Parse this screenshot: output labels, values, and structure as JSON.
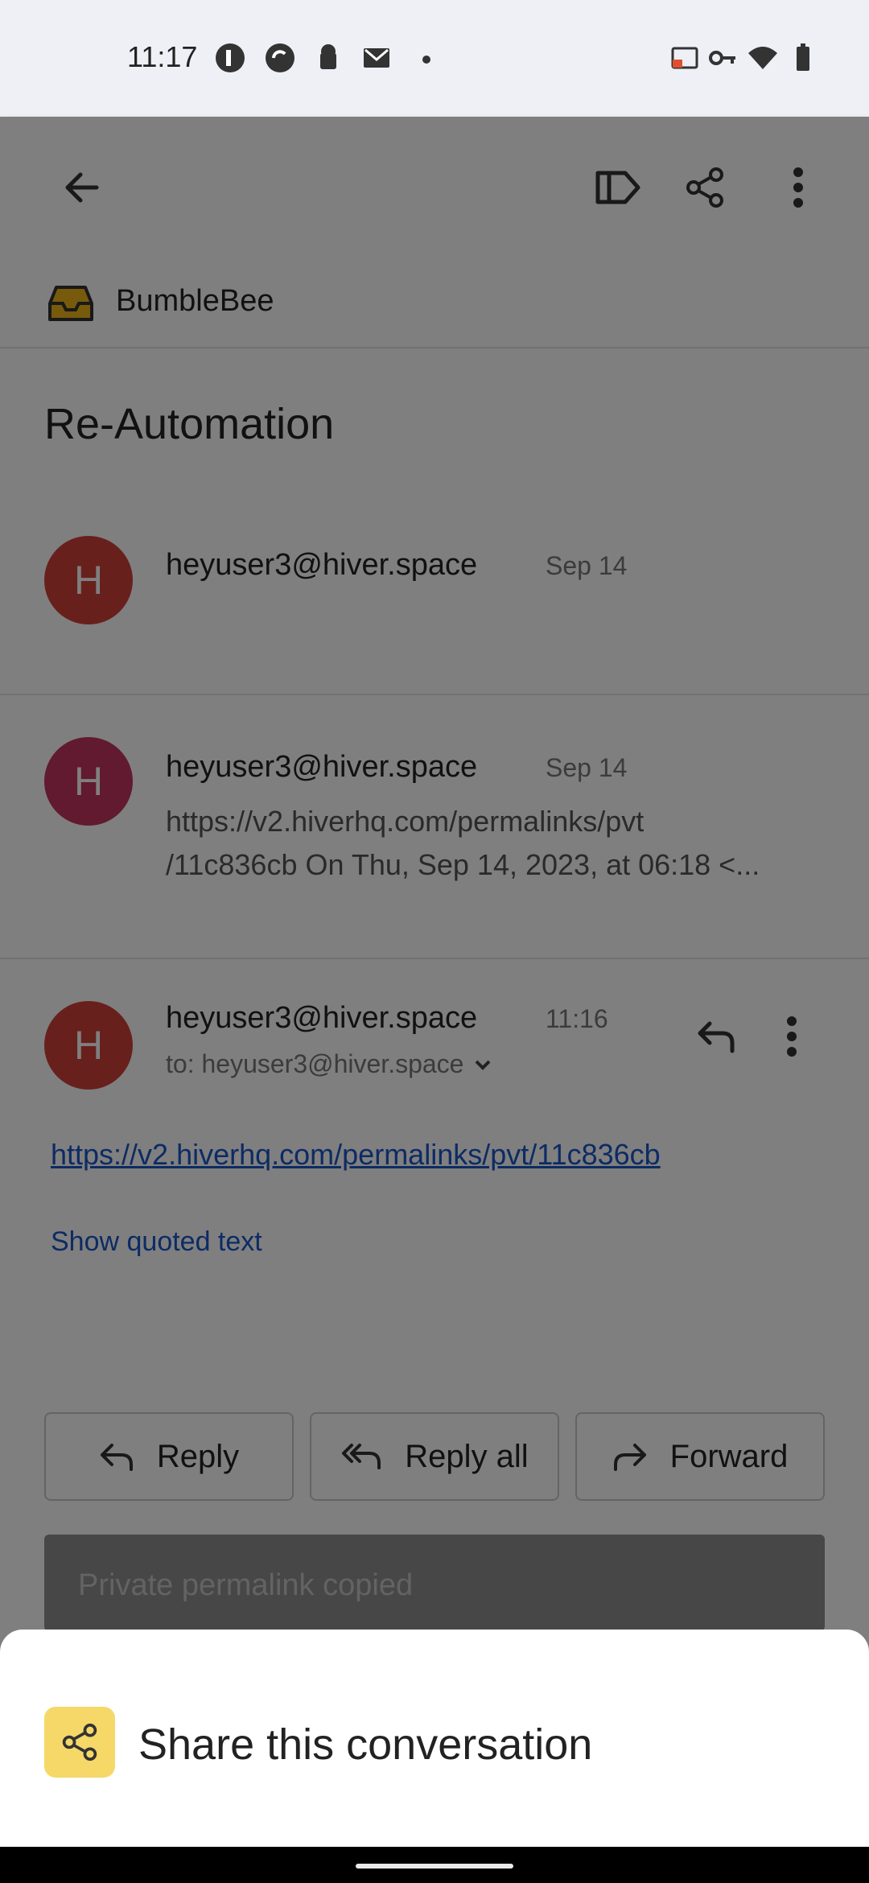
{
  "status_bar": {
    "time": "11:17"
  },
  "app_bar": {
    "icons": [
      "back-arrow-icon",
      "label-icon",
      "share-icon",
      "more-vert-icon"
    ]
  },
  "inbox": {
    "label": "BumbleBee"
  },
  "conversation": {
    "subject": "Re-Automation",
    "messages": [
      {
        "avatar_letter": "H",
        "avatar_color": "#d0413a",
        "sender": "heyuser3@hiver.space",
        "date": "Sep 14"
      },
      {
        "avatar_letter": "H",
        "avatar_color": "#c2345f",
        "sender": "heyuser3@hiver.space",
        "date": "Sep 14",
        "snippet_line1": "https://v2.hiverhq.com/permalinks/pvt",
        "snippet_line2": "/11c836cb On Thu, Sep 14, 2023, at 06:18 <..."
      },
      {
        "avatar_letter": "H",
        "avatar_color": "#d0413a",
        "sender": "heyuser3@hiver.space",
        "date": "11:16",
        "to": "to: heyuser3@hiver.space",
        "body_link": "https://v2.hiverhq.com/permalinks/pvt/11c836cb",
        "show_quoted": "Show quoted text"
      }
    ]
  },
  "actions": {
    "reply": "Reply",
    "reply_all": "Reply all",
    "forward": "Forward"
  },
  "snackbar": {
    "text": "Private permalink copied"
  },
  "bottom_sheet": {
    "share_label": "Share this conversation",
    "badge_color": "#f5d867"
  }
}
